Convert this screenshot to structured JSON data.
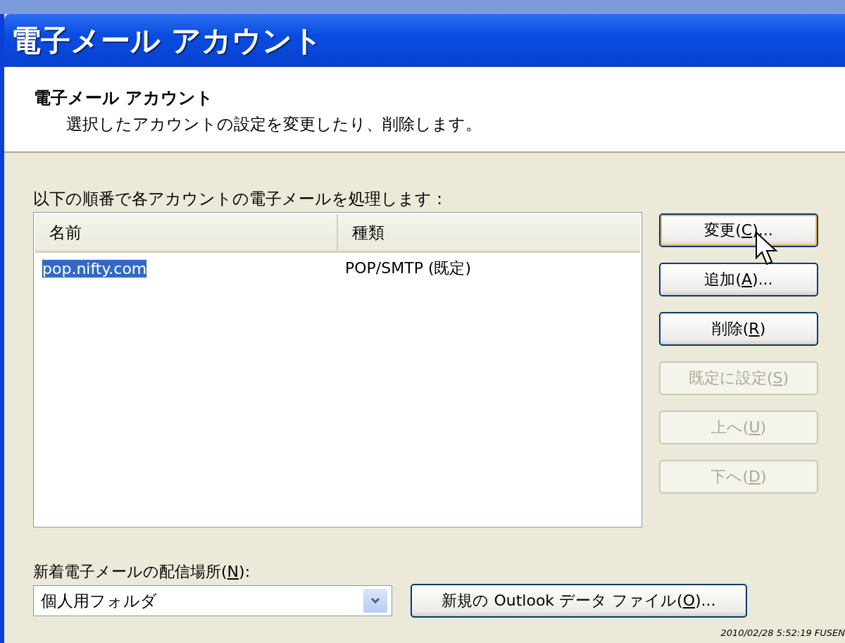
{
  "window": {
    "title": "電子メール アカウント"
  },
  "header": {
    "title": "電子メール アカウント",
    "subtitle": "選択したアカウントの設定を変更したり、削除します。"
  },
  "list_label": "以下の順番で各アカウントの電子メールを処理します :",
  "table": {
    "columns": [
      "名前",
      "種類"
    ],
    "rows": [
      {
        "cells": [
          "pop.nifty.com",
          "POP/SMTP (既定)"
        ],
        "selected": true
      }
    ]
  },
  "buttons": [
    {
      "text": "変更(",
      "accel": "C",
      "after": ")...",
      "disabled": false,
      "focused": true
    },
    {
      "text": "追加(",
      "accel": "A",
      "after": ")...",
      "disabled": false,
      "focused": false
    },
    {
      "text": "削除(",
      "accel": "R",
      "after": ")",
      "disabled": false,
      "focused": false
    },
    {
      "text": "既定に設定(",
      "accel": "S",
      "after": ")",
      "disabled": true,
      "focused": false
    },
    {
      "text": "上へ(",
      "accel": "U",
      "after": ")",
      "disabled": true,
      "focused": false
    },
    {
      "text": "下へ(",
      "accel": "D",
      "after": ")",
      "disabled": true,
      "focused": false
    }
  ],
  "delivery": {
    "label": {
      "text": "新着電子メールの配信場所(",
      "accel": "N",
      "after": "):"
    },
    "value": "個人用フォルダ",
    "button": {
      "text": "新規の Outlook データ ファイル(",
      "accel": "O",
      "after": ")..."
    }
  },
  "capture_stamp": "2010/02/28 5:52:19 FUSEN"
}
